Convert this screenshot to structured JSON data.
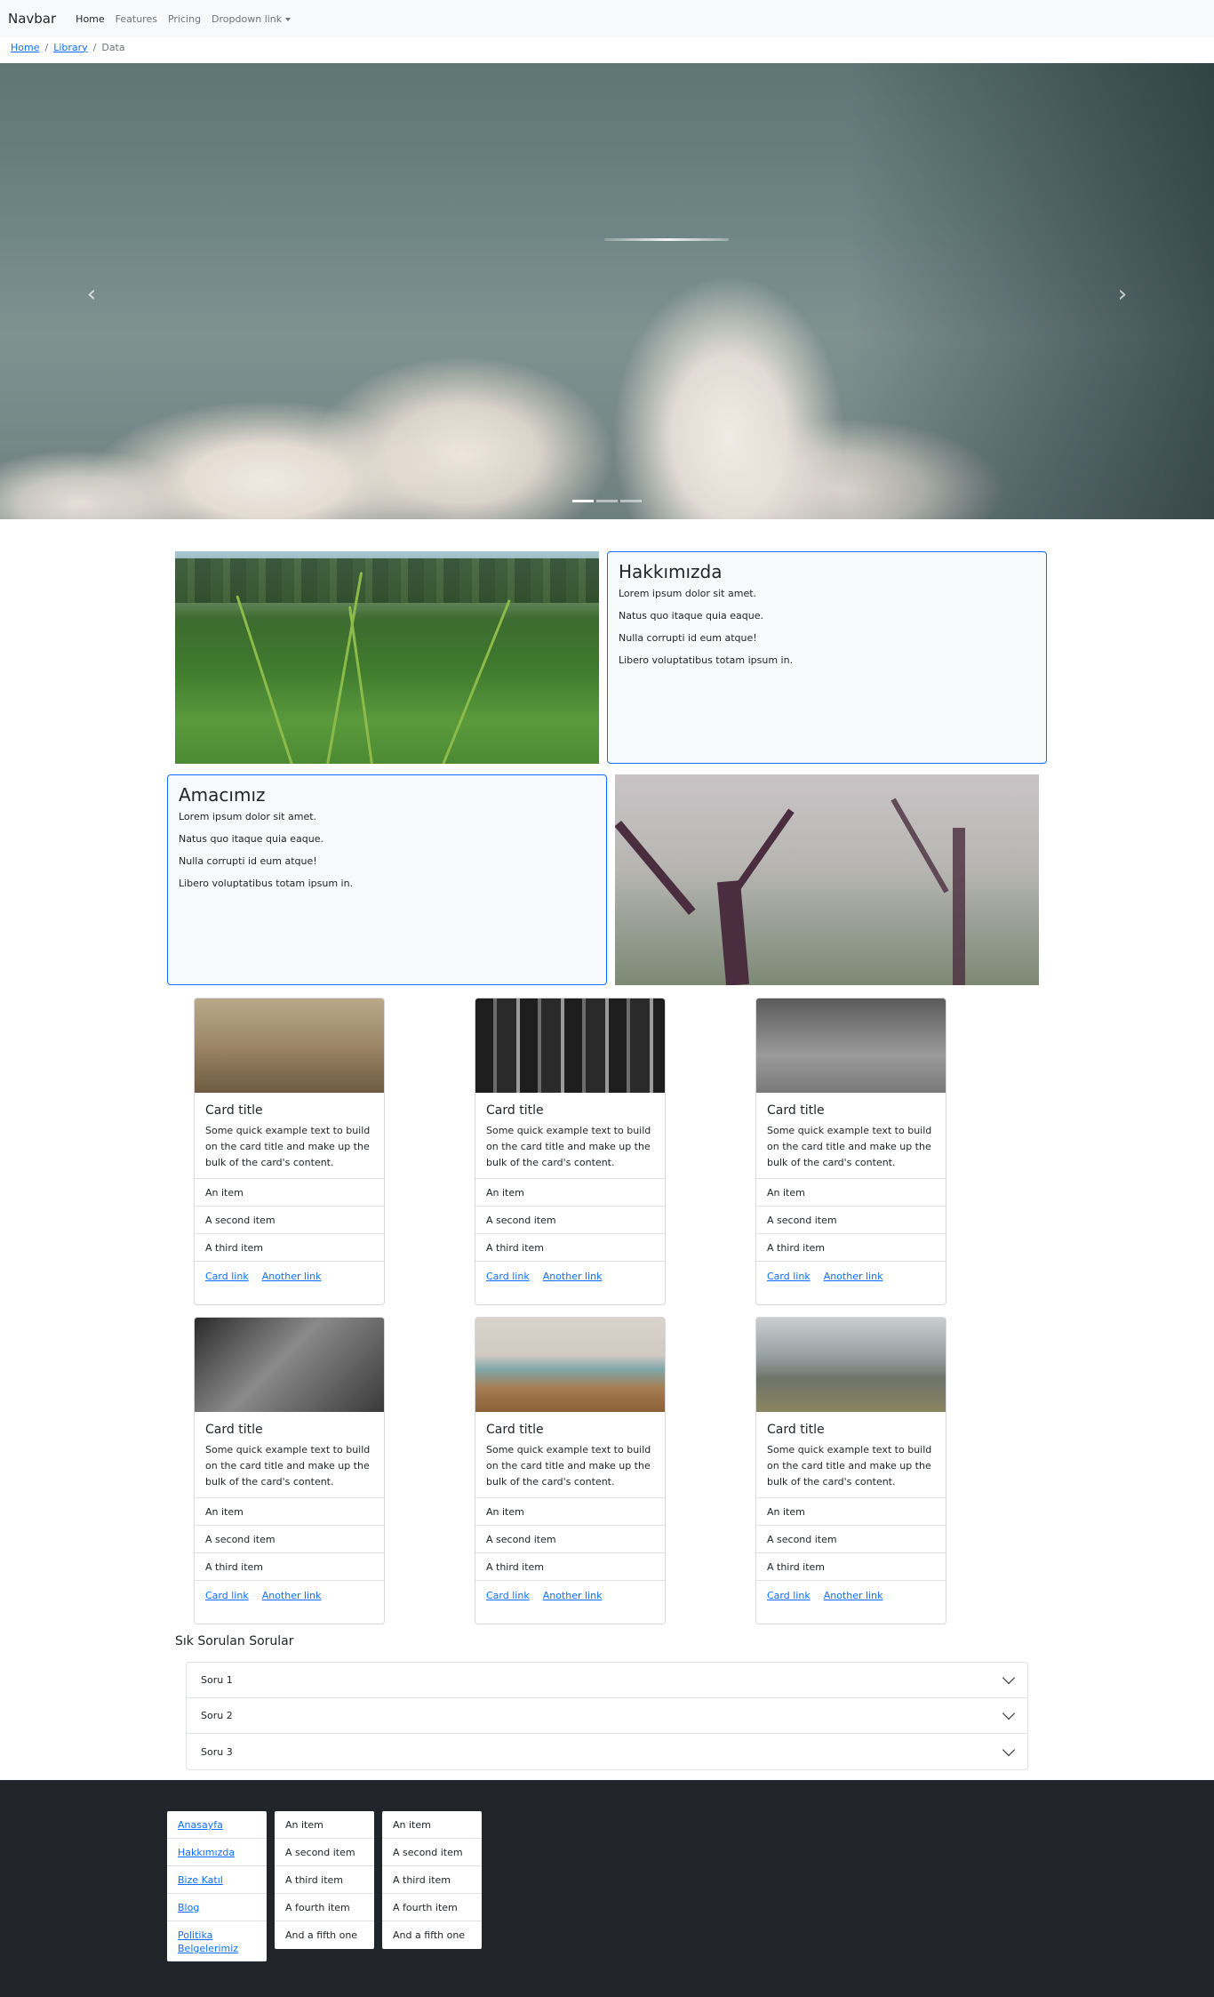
{
  "navbar": {
    "brand": "Navbar",
    "links": [
      "Home",
      "Features",
      "Pricing",
      "Dropdown link"
    ]
  },
  "breadcrumb": {
    "home": "Home",
    "library": "Library",
    "current": "Data",
    "separator": "/"
  },
  "hero": {
    "prev_icon": "‹",
    "next_icon": "›",
    "indicator_count": 3,
    "active_indicator": 1
  },
  "about": {
    "title": "Hakkımızda",
    "lines": [
      "Lorem ipsum dolor sit amet.",
      "Natus quo itaque quia eaque.",
      "Nulla corrupti id eum atque!",
      "Libero voluptatibus totam ipsum in."
    ]
  },
  "purpose": {
    "title": "Amacımız",
    "lines": [
      "Lorem ipsum dolor sit amet.",
      "Natus quo itaque quia eaque.",
      "Nulla corrupti id eum atque!",
      "Libero voluptatibus totam ipsum in."
    ]
  },
  "cards": {
    "title": "Card title",
    "text": "Some quick example text to build on the card title and make up the bulk of the card's content.",
    "items": [
      "An item",
      "A second item",
      "A third item"
    ],
    "link1": "Card link",
    "link2": "Another link"
  },
  "faq": {
    "title": "Sık Sorulan Sorular",
    "questions": [
      "Soru 1",
      "Soru 2",
      "Soru 3"
    ]
  },
  "footer": {
    "links": [
      "Anasayfa",
      "Hakkımızda",
      "Bize Katıl",
      "Blog",
      "Politika Belgelerimiz"
    ],
    "list": [
      "An item",
      "A second item",
      "A third item",
      "A fourth item",
      "And a fifth one"
    ]
  }
}
